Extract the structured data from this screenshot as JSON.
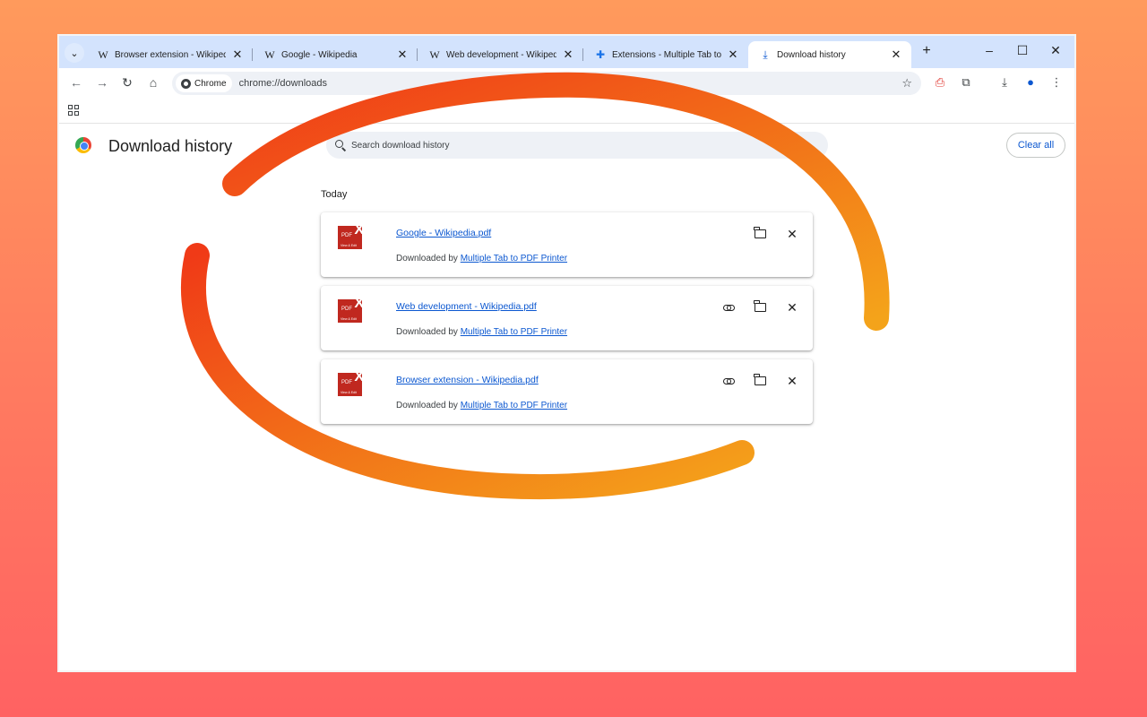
{
  "tabs": [
    {
      "favicon": "W",
      "title": "Browser extension - Wikipedia",
      "active": false
    },
    {
      "favicon": "W",
      "title": "Google - Wikipedia",
      "active": false
    },
    {
      "favicon": "W",
      "title": "Web development - Wikipedia",
      "active": false
    },
    {
      "favicon": "puzzle-icon",
      "title": "Extensions - Multiple Tab to PDF",
      "active": false
    },
    {
      "favicon": "download-icon",
      "title": "Download history",
      "active": true
    }
  ],
  "toolbar": {
    "chip_label": "Chrome",
    "url": "chrome://downloads"
  },
  "page": {
    "title": "Download history",
    "search_placeholder": "Search download history",
    "clear_all": "Clear all",
    "section": "Today"
  },
  "downloads": [
    {
      "file": "Google - Wikipedia.pdf",
      "by_prefix": "Downloaded by",
      "by_link": "Multiple Tab to PDF Printer",
      "has_link_action": false
    },
    {
      "file": "Web development - Wikipedia.pdf",
      "by_prefix": "Downloaded by",
      "by_link": "Multiple Tab to PDF Printer",
      "has_link_action": true
    },
    {
      "file": "Browser extension - Wikipedia.pdf",
      "by_prefix": "Downloaded by",
      "by_link": "Multiple Tab to PDF Printer",
      "has_link_action": true
    }
  ],
  "file_icon": {
    "badge": "PDF",
    "mark": "X",
    "sub": "View & Edit"
  },
  "colors": {
    "accent": "#0b57d0",
    "tabstrip": "#d3e3fd",
    "swirl_start": "#f03a17",
    "swirl_end": "#f4a31a"
  }
}
